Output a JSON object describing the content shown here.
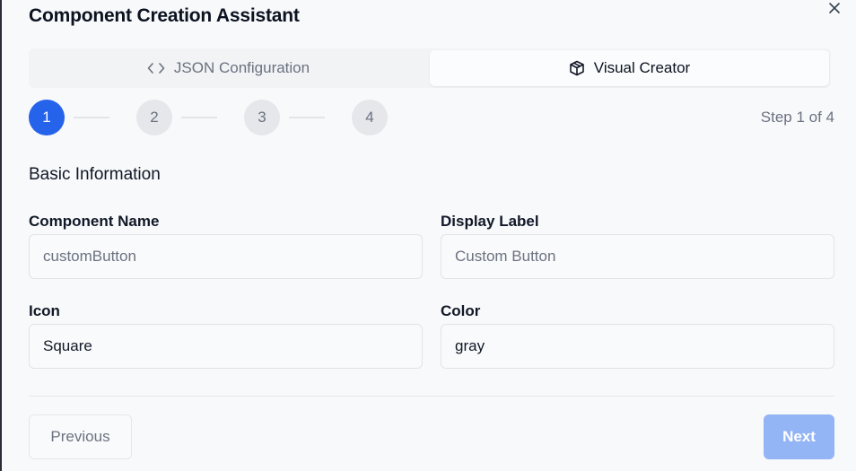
{
  "dialog": {
    "title": "Component Creation Assistant"
  },
  "tabs": [
    {
      "label": "JSON Configuration",
      "icon": "code-icon",
      "active": false
    },
    {
      "label": "Visual Creator",
      "icon": "box-icon",
      "active": true
    }
  ],
  "stepper": {
    "steps": [
      "1",
      "2",
      "3",
      "4"
    ],
    "current": 1,
    "status": "Step 1 of 4"
  },
  "form": {
    "section_title": "Basic Information",
    "component_name": {
      "label": "Component Name",
      "placeholder": "customButton",
      "value": ""
    },
    "display_label": {
      "label": "Display Label",
      "placeholder": "Custom Button",
      "value": ""
    },
    "icon": {
      "label": "Icon",
      "value": "Square"
    },
    "color": {
      "label": "Color",
      "value": "gray"
    }
  },
  "footer": {
    "previous_label": "Previous",
    "next_label": "Next"
  },
  "colors": {
    "accent": "#2563eb",
    "accent_disabled": "#93b4f5",
    "muted_text": "#6b7280"
  }
}
